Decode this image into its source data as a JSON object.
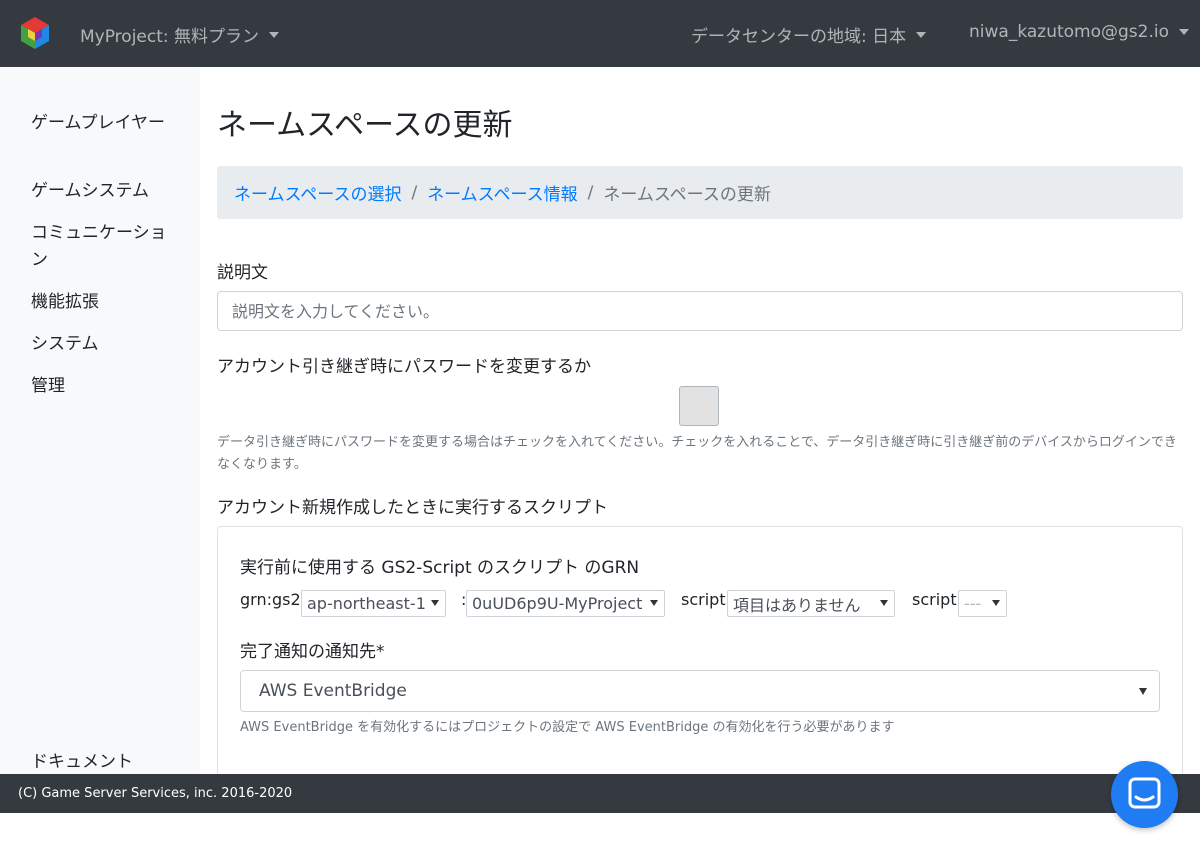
{
  "navbar": {
    "project_label": "MyProject: 無料プラン",
    "region_label": "データセンターの地域: 日本",
    "user_label": "niwa_kazutomo@gs2.io"
  },
  "sidebar": {
    "items": [
      {
        "label": "ゲームプレイヤー"
      },
      {
        "label": "ゲームシステム"
      },
      {
        "label": "コミュニケーション"
      },
      {
        "label": "機能拡張"
      },
      {
        "label": "システム"
      },
      {
        "label": "管理"
      }
    ],
    "doc_label": "ドキュメント"
  },
  "page": {
    "title": "ネームスペースの更新"
  },
  "breadcrumb": {
    "items": [
      {
        "label": "ネームスペースの選択"
      },
      {
        "label": "ネームスペース情報"
      },
      {
        "label": "ネームスペースの更新"
      }
    ],
    "separator": "/"
  },
  "form": {
    "description_label": "説明文",
    "description_placeholder": "説明文を入力してください。",
    "description_value": "",
    "change_password_label": "アカウント引き継ぎ時にパスワードを変更するか",
    "change_password_checked": false,
    "change_password_help": "データ引き継ぎ時にパスワードを変更する場合はチェックを入れてください。チェックを入れることで、データ引き継ぎ時に引き継ぎ前のデバイスからログインできなくなります。",
    "create_script_label": "アカウント新規作成したときに実行するスクリプト",
    "script_card": {
      "grn_label": "実行前に使用する GS2-Script のスクリプト のGRN",
      "grn_prefix": "grn:gs2:",
      "region_select": "ap-northeast-1",
      "colon": ":",
      "owner_select": "0uUD6p9U-MyProject",
      "script_label_1": "script:",
      "namespace_select": "項目はありません",
      "script_label_2": "script:",
      "script_select": "---",
      "notification_label": "完了通知の通知先*",
      "notification_select": "AWS EventBridge",
      "notification_help": "AWS EventBridge を有効化するにはプロジェクトの設定で AWS EventBridge の有効化を行う必要があります"
    }
  },
  "footer": {
    "copyright": "(C) Game Server Services, inc. 2016-2020"
  },
  "colors": {
    "navbar_bg": "#343a40",
    "link": "#007bff",
    "chat_button": "#1f7cf3"
  }
}
